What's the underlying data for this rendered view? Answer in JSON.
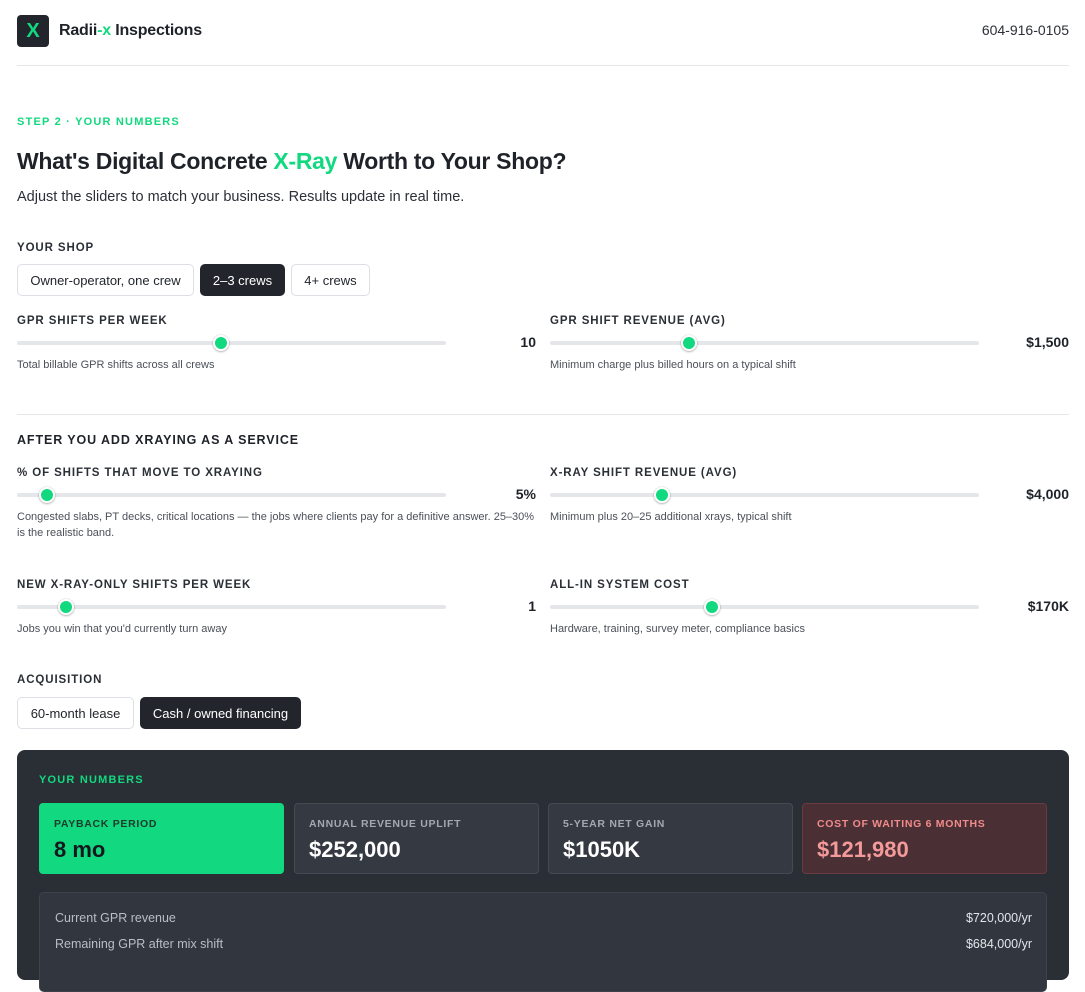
{
  "header": {
    "logo_glyph": "X",
    "brand_name_a": "Radii",
    "brand_name_b": "-x",
    "brand_name_c": " Inspections",
    "phone": "604-916-0105"
  },
  "intro": {
    "eyebrow": "STEP 2 · YOUR NUMBERS",
    "title_a": "What's Digital Concrete ",
    "title_accent": "X-Ray",
    "title_b": " Worth to Your Shop?",
    "subtitle": "Adjust the sliders to match your business. Results update in real time."
  },
  "shop": {
    "label": "YOUR SHOP",
    "options": [
      "Owner-operator, one crew",
      "2–3 crews",
      "4+ crews"
    ],
    "selected": "2–3 crews"
  },
  "sliders": {
    "gpr_shifts": {
      "label": "GPR SHIFTS PER WEEK",
      "value": "10",
      "help": "Total billable GPR shifts across all crews",
      "fraction": 0.475
    },
    "gpr_revenue": {
      "label": "GPR SHIFT REVENUE (AVG)",
      "value": "$1,500",
      "help": "Minimum charge plus billed hours on a typical shift",
      "fraction": 0.325
    },
    "xray_pct": {
      "label": "% OF SHIFTS THAT MOVE TO XRAYING",
      "value": "5%",
      "help": "Congested slabs, PT decks, critical locations — the jobs where clients pay for a definitive answer. 25–30% is the realistic band.",
      "fraction": 0.07
    },
    "xray_revenue": {
      "label": "X-RAY SHIFT REVENUE (AVG)",
      "value": "$4,000",
      "help": "Minimum plus 20–25 additional xrays, typical shift",
      "fraction": 0.26
    },
    "new_shifts": {
      "label": "NEW X-RAY-ONLY SHIFTS PER WEEK",
      "value": "1",
      "help": "Jobs you win that you'd currently turn away",
      "fraction": 0.115
    },
    "system_cost": {
      "label": "ALL-IN SYSTEM COST",
      "value": "$170K",
      "help": "Hardware, training, survey meter, compliance basics",
      "fraction": 0.378
    }
  },
  "after_section": {
    "label": "AFTER YOU ADD XRAYING AS A SERVICE"
  },
  "acquisition": {
    "label": "ACQUISITION",
    "options": [
      "60-month lease",
      "Cash / owned financing"
    ],
    "selected": "Cash / owned financing"
  },
  "results": {
    "label": "YOUR NUMBERS",
    "cards": [
      {
        "label": "PAYBACK PERIOD",
        "value": "8 mo"
      },
      {
        "label": "ANNUAL REVENUE UPLIFT",
        "value": "$252,000"
      },
      {
        "label": "5-YEAR NET GAIN",
        "value": "$1050K"
      },
      {
        "label": "COST OF WAITING 6 MONTHS",
        "value": "$121,980"
      }
    ],
    "breakdown": [
      {
        "label": "Current GPR revenue",
        "value": "$720,000/yr"
      },
      {
        "label": "Remaining GPR after mix shift",
        "value": "$684,000/yr"
      }
    ]
  },
  "colors": {
    "accent": "#12d97f",
    "dark": "#22262c",
    "panel": "#2a2e35",
    "warn": "#f59a9a"
  }
}
